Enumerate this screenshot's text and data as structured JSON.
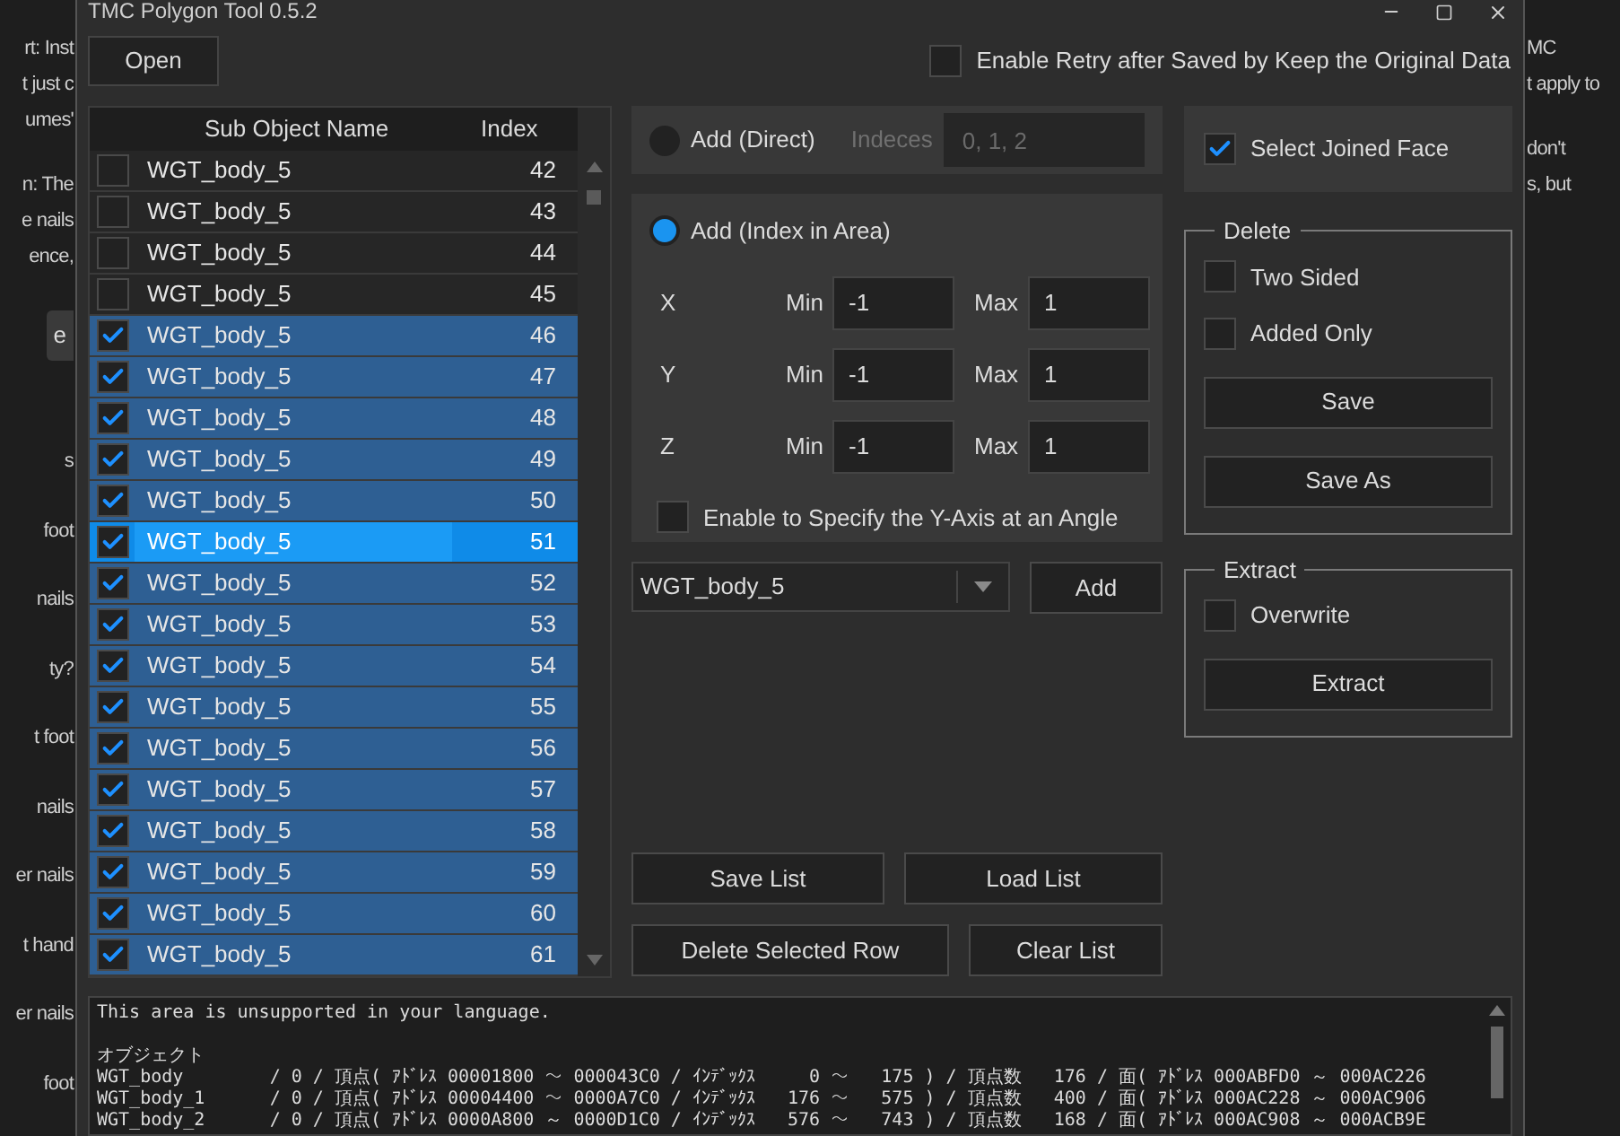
{
  "background": {
    "left_paragraphs": [
      [
        "rt: Inst",
        "t just c",
        "umes'"
      ],
      [
        "n: The",
        "e nails",
        "ence,"
      ]
    ],
    "left_button": "e",
    "left_items": [
      "s",
      "foot",
      "nails",
      "ty?",
      "t foot",
      "nails",
      "er nails",
      "t hand",
      "er nails",
      "foot"
    ],
    "right_paragraphs": [
      [
        "MC",
        "t apply to"
      ],
      [
        "don't",
        "s, but"
      ]
    ]
  },
  "window": {
    "title": "TMC Polygon Tool 0.5.2"
  },
  "open_button": "Open",
  "retry_option": {
    "label": "Enable Retry after Saved by Keep the Original Data",
    "checked": false
  },
  "table": {
    "columns": [
      "Sub Object Name",
      "Index"
    ],
    "rows": [
      {
        "checked": false,
        "selected": false,
        "name": "WGT_body_5",
        "index": "42"
      },
      {
        "checked": false,
        "selected": false,
        "name": "WGT_body_5",
        "index": "43"
      },
      {
        "checked": false,
        "selected": false,
        "name": "WGT_body_5",
        "index": "44"
      },
      {
        "checked": false,
        "selected": false,
        "name": "WGT_body_5",
        "index": "45"
      },
      {
        "checked": true,
        "selected": false,
        "name": "WGT_body_5",
        "index": "46"
      },
      {
        "checked": true,
        "selected": false,
        "name": "WGT_body_5",
        "index": "47"
      },
      {
        "checked": true,
        "selected": false,
        "name": "WGT_body_5",
        "index": "48"
      },
      {
        "checked": true,
        "selected": false,
        "name": "WGT_body_5",
        "index": "49"
      },
      {
        "checked": true,
        "selected": false,
        "name": "WGT_body_5",
        "index": "50"
      },
      {
        "checked": true,
        "selected": true,
        "name": "WGT_body_5",
        "index": "51"
      },
      {
        "checked": true,
        "selected": false,
        "name": "WGT_body_5",
        "index": "52"
      },
      {
        "checked": true,
        "selected": false,
        "name": "WGT_body_5",
        "index": "53"
      },
      {
        "checked": true,
        "selected": false,
        "name": "WGT_body_5",
        "index": "54"
      },
      {
        "checked": true,
        "selected": false,
        "name": "WGT_body_5",
        "index": "55"
      },
      {
        "checked": true,
        "selected": false,
        "name": "WGT_body_5",
        "index": "56"
      },
      {
        "checked": true,
        "selected": false,
        "name": "WGT_body_5",
        "index": "57"
      },
      {
        "checked": true,
        "selected": false,
        "name": "WGT_body_5",
        "index": "58"
      },
      {
        "checked": true,
        "selected": false,
        "name": "WGT_body_5",
        "index": "59"
      },
      {
        "checked": true,
        "selected": false,
        "name": "WGT_body_5",
        "index": "60"
      },
      {
        "checked": true,
        "selected": false,
        "name": "WGT_body_5",
        "index": "61"
      }
    ]
  },
  "add_direct": {
    "label": "Add (Direct)",
    "selected": false,
    "disabled": true,
    "indices_label": "Indeces",
    "indices_placeholder": "0, 1, 2"
  },
  "add_area": {
    "label": "Add (Index in Area)",
    "selected": true,
    "axes": [
      {
        "axis": "X",
        "min_label": "Min",
        "min": "-1",
        "max_label": "Max",
        "max": "1"
      },
      {
        "axis": "Y",
        "min_label": "Min",
        "min": "-1",
        "max_label": "Max",
        "max": "1"
      },
      {
        "axis": "Z",
        "min_label": "Min",
        "min": "-1",
        "max_label": "Max",
        "max": "1"
      }
    ],
    "angle_option": {
      "label": "Enable to Specify the Y-Axis at an Angle",
      "checked": false
    }
  },
  "object_select": {
    "value": "WGT_body_5"
  },
  "add_button": "Add",
  "list_buttons": [
    "Save List",
    "Load List",
    "Delete Selected Row",
    "Clear List"
  ],
  "joined_face": {
    "label": "Select Joined Face",
    "checked": true
  },
  "delete_group": {
    "title": "Delete",
    "options": [
      {
        "label": "Two Sided",
        "checked": false
      },
      {
        "label": "Added Only",
        "checked": false
      }
    ],
    "buttons": [
      "Save",
      "Save As"
    ]
  },
  "extract_group": {
    "title": "Extract",
    "options": [
      {
        "label": "Overwrite",
        "checked": false
      }
    ],
    "buttons": [
      "Extract"
    ]
  },
  "log": {
    "notice": "This area is unsupported in your language.",
    "heading": "オブジェクト",
    "lines": [
      "WGT_body        / 0 / 頂点( ｱﾄﾞﾚｽ 00001800 ～ 000043C0 / ｲﾝﾃﾞｯｸｽ     0 ～   175 ) / 頂点数   176 / 面( ｱﾄﾞﾚｽ 000ABFD0 ～ 000AC226",
      "WGT_body_1      / 0 / 頂点( ｱﾄﾞﾚｽ 00004400 ～ 0000A7C0 / ｲﾝﾃﾞｯｸｽ   176 ～   575 ) / 頂点数   400 / 面( ｱﾄﾞﾚｽ 000AC228 ～ 000AC906",
      "WGT_body_2      / 0 / 頂点( ｱﾄﾞﾚｽ 0000A800 ～ 0000D1C0 / ｲﾝﾃﾞｯｸｽ   576 ～   743 ) / 頂点数   168 / 面( ｱﾄﾞﾚｽ 000AC908 ～ 000ACB9E"
    ]
  }
}
